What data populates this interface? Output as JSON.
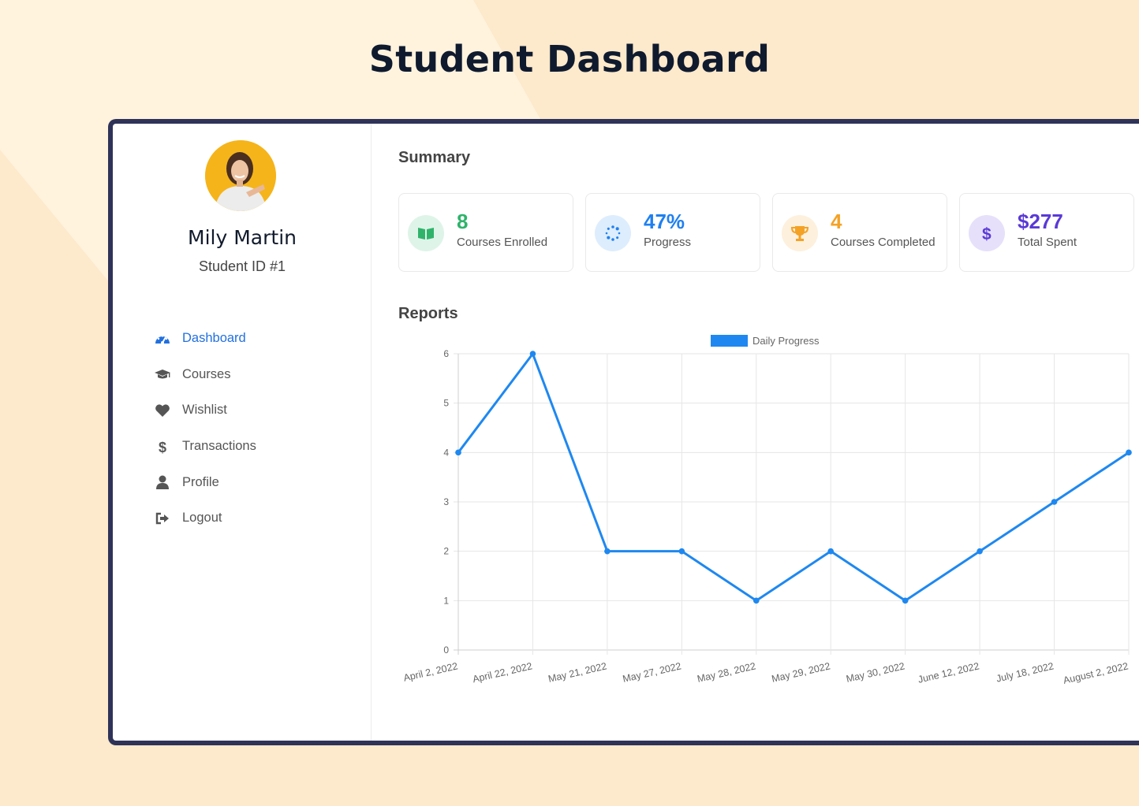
{
  "page": {
    "title": "Student Dashboard"
  },
  "user": {
    "name": "Mily Martin",
    "student_id": "Student ID #1"
  },
  "nav": {
    "items": [
      {
        "label": "Dashboard",
        "icon": "dashboard-gauge-icon",
        "active": true
      },
      {
        "label": "Courses",
        "icon": "graduation-cap-icon",
        "active": false
      },
      {
        "label": "Wishlist",
        "icon": "heart-icon",
        "active": false
      },
      {
        "label": "Transactions",
        "icon": "dollar-icon",
        "active": false
      },
      {
        "label": "Profile",
        "icon": "user-icon",
        "active": false
      },
      {
        "label": "Logout",
        "icon": "sign-out-icon",
        "active": false
      }
    ]
  },
  "summary": {
    "title": "Summary",
    "cards": [
      {
        "value": "8",
        "label": "Courses Enrolled",
        "icon": "book-icon",
        "color": "#2fb36b",
        "tint": "#dff4e8"
      },
      {
        "value": "47%",
        "label": "Progress",
        "icon": "spinner-icon",
        "color": "#1f80f0",
        "tint": "#ddedfd"
      },
      {
        "value": "4",
        "label": "Courses Completed",
        "icon": "trophy-icon",
        "color": "#f4a226",
        "tint": "#fdf0dd"
      },
      {
        "value": "$277",
        "label": "Total Spent",
        "icon": "dollar-icon",
        "color": "#5a3ad6",
        "tint": "#e6e0fb"
      }
    ]
  },
  "reports": {
    "title": "Reports"
  },
  "chart_data": {
    "type": "line",
    "categories": [
      "April 2, 2022",
      "April 22, 2022",
      "May 21, 2022",
      "May 27, 2022",
      "May 28, 2022",
      "May 29, 2022",
      "May 30, 2022",
      "June 12, 2022",
      "July 18, 2022",
      "August 2, 2022"
    ],
    "series": [
      {
        "name": "Daily Progress",
        "values": [
          4,
          6,
          2,
          2,
          1,
          2,
          1,
          2,
          3,
          4
        ],
        "color": "#1e88f0"
      }
    ],
    "ylim": [
      0,
      6
    ],
    "yticks": [
      0,
      1,
      2,
      3,
      4,
      5,
      6
    ],
    "grid": true,
    "legend": "top-center"
  }
}
